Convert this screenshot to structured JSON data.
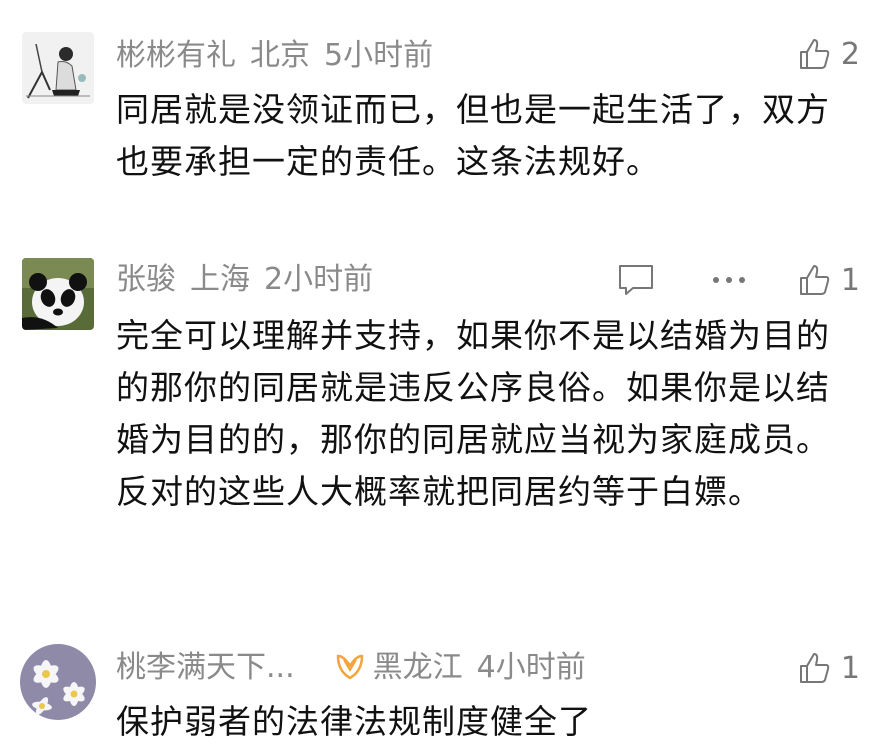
{
  "comments": [
    {
      "username": "彬彬有礼",
      "location": "北京",
      "time": "5小时前",
      "likes": "2",
      "text": "同居就是没领证而已，但也是一起生活了，双方也要承担一定的责任。这条法规好。",
      "show_reply": false,
      "show_more": false,
      "vip": false,
      "avatar": "sketch-avatar"
    },
    {
      "username": "张骏",
      "location": "上海",
      "time": "2小时前",
      "likes": "1",
      "text": "完全可以理解并支持，如果你不是以结婚为目的的那你的同居就是违反公序良俗。如果你是以结婚为目的的，那你的同居就应当视为家庭成员。反对的这些人大概率就把同居约等于白嫖。",
      "show_reply": true,
      "show_more": true,
      "vip": false,
      "avatar": "panda-avatar"
    },
    {
      "username": "桃李满天下...",
      "location": "黑龙江",
      "time": "4小时前",
      "likes": "1",
      "text": "保护弱者的法律法规制度健全了",
      "show_reply": false,
      "show_more": false,
      "vip": true,
      "avatar": "flower-avatar"
    }
  ],
  "icons": {
    "like": "thumb-up-icon",
    "reply": "comment-bubble-icon",
    "more": "more-dots-icon",
    "vip": "vip-badge-icon"
  },
  "colors": {
    "meta": "#8a8a8a",
    "text": "#111111",
    "vip": "#f3a43b"
  }
}
